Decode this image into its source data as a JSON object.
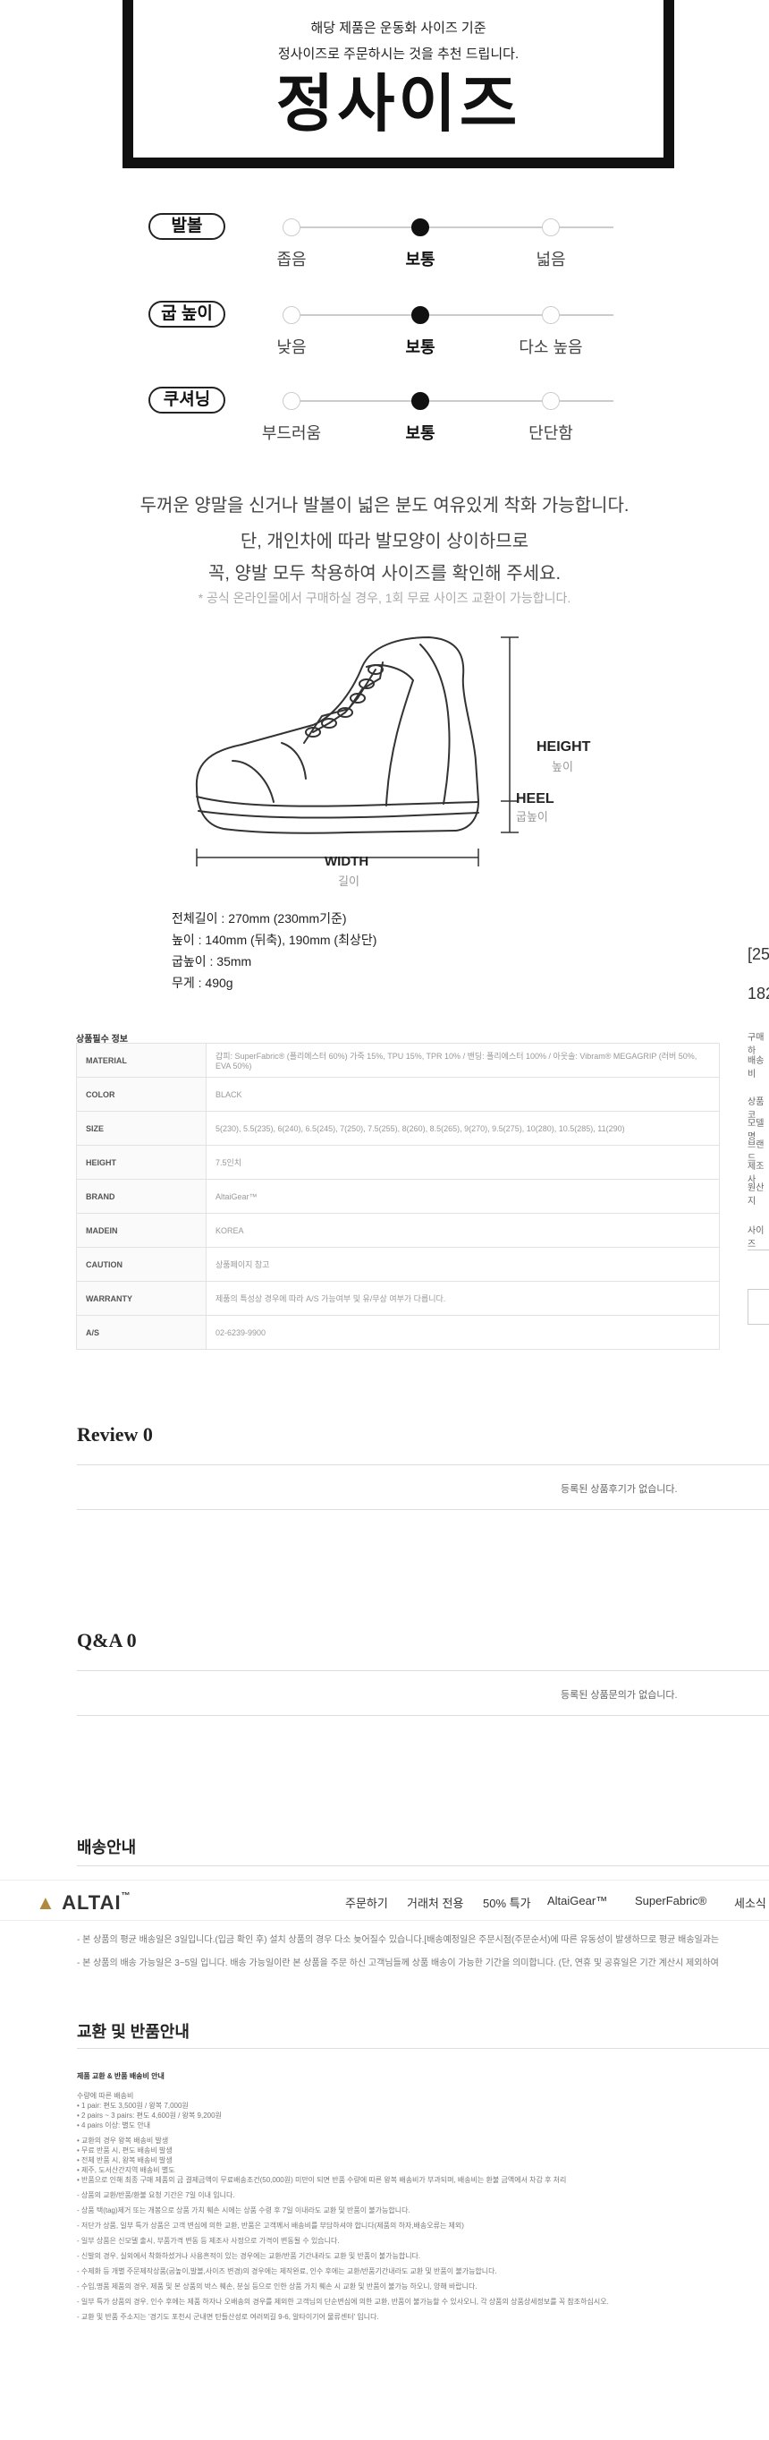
{
  "size_box": {
    "line1": "해당 제품은 운동화 사이즈 기준",
    "line2": "정사이즈로 주문하시는 것을 추천 드립니다.",
    "big": "정사이즈"
  },
  "scales": [
    {
      "tag": "발볼",
      "labels": [
        "좁음",
        "보통",
        "넓음"
      ],
      "selected": 1
    },
    {
      "tag": "굽 높이",
      "labels": [
        "낮음",
        "보통",
        "다소 높음"
      ],
      "selected": 1
    },
    {
      "tag": "쿠셔닝",
      "labels": [
        "부드러움",
        "보통",
        "단단함"
      ],
      "selected": 1
    }
  ],
  "description": {
    "line1": "두꺼운 양말을 신거나 발볼이 넓은 분도 여유있게 착화 가능합니다.",
    "line2": "단, 개인차에 따라 발모양이 상이하므로",
    "line3": "꼭, 양발 모두 착용하여 사이즈를 확인해 주세요.",
    "note": "* 공식 온라인몰에서 구매하실 경우, 1회 무료 사이즈 교환이 가능합니다."
  },
  "diagram": {
    "height_label": "HEIGHT",
    "height_sub": "높이",
    "heel_label": "HEEL",
    "heel_sub": "굽높이",
    "width_label": "WIDTH",
    "width_sub": "길이"
  },
  "specs": [
    "전체길이 : 270mm (230mm기준)",
    "높이 : 140mm (뒤축), 190mm (최상단)",
    "굽높이 : 35mm",
    "무게 : 490g"
  ],
  "product_info": {
    "title": "상품필수 정보",
    "rows": [
      {
        "key": "MATERIAL",
        "value": "갑피: SuperFabric® (폴리에스터 60%) 가죽 15%, TPU 15%, TPR 10% / 밴딩: 폴리에스터 100% / 아웃솔: Vibram® MEGAGRIP (러버 50%, EVA 50%)"
      },
      {
        "key": "COLOR",
        "value": "BLACK"
      },
      {
        "key": "SIZE",
        "value": "5(230), 5.5(235), 6(240), 6.5(245), 7(250), 7.5(255), 8(260), 8.5(265), 9(270), 9.5(275), 10(280), 10.5(285), 11(290)"
      },
      {
        "key": "HEIGHT",
        "value": "7.5인치"
      },
      {
        "key": "BRAND",
        "value": "AltaiGear™"
      },
      {
        "key": "MADEIN",
        "value": "KOREA"
      },
      {
        "key": "CAUTION",
        "value": "상품페이지 참고"
      },
      {
        "key": "WARRANTY",
        "value": "제품의 특성상 경우에 따라 A/S 가능여부 및 유/무상 여부가 다릅니다."
      },
      {
        "key": "A/S",
        "value": "02-6239-9900"
      }
    ]
  },
  "review": {
    "title": "Review 0",
    "empty": "등록된 상품후기가 없습니다."
  },
  "qna": {
    "title": "Q&A 0",
    "empty": "등록된 상품문의가 없습니다."
  },
  "shipping": {
    "title": "배송안내",
    "line1": "- 본 상품의 평균 배송일은 3일입니다.(입금 확인 후) 설치 상품의 경우 다소 늦어질수 있습니다.[배송예정일은 주문시점(주문순서)에 따른 유동성이 발생하므로 평균 배송일과는",
    "line2": "- 본 상품의 배송 가능일은 3~5일 입니다. 배송 가능일이란 본 상품을 주문 하신 고객님들께 상품 배송이 가능한 기간을 의미합니다. (단, 연휴 및 공휴일은 기간 계산시 제외하여"
  },
  "navbar": {
    "logo": "ALTAI",
    "logo_mark": "™",
    "items": [
      "주문하기",
      "거래처 전용",
      "50% 특가",
      "AltaiGear™",
      "SuperFabric®",
      "세소식"
    ]
  },
  "exchange": {
    "title": "교환 및 반품안내",
    "heading": "제품 교환 & 반품 배송비 안내",
    "lines": [
      "수량에 따른 배송비",
      "• 1 pair: 편도 3,500원 / 왕복 7,000원",
      "• 2 pairs ~ 3 pairs: 편도 4,600원 / 왕복 9,200원",
      "• 4 pairs 이상: 별도 안내",
      "",
      "• 교환의 경우 왕복 배송비 발생",
      "• 무료 반품 시, 편도 배송비 발생",
      "• 전체 반품 시, 왕복 배송비 발생",
      "• 제주, 도서산간지역 배송비 별도",
      "• 반품으로 인해 최종 구매 제품의 금 결제금액이 무료배송조건(50,000원) 미만이 되면 반품 수량에 따른 왕복 배송비가 부과되며, 배송비는 환불 금액에서 차감 후 처리",
      "",
      "- 상품의 교환/반품/환불 요청 기간은 7일 이내 입니다.",
      "",
      "- 상품 택(tag)제거 또는 개봉으로 상품 가치 훼손 시에는 상품 수령 후 7일 이내라도 교환 및 반품이 불가능합니다.",
      "",
      "- 저단가 상품, 일부 특가 상품은 고객 변심에 의한 교환, 반품은 고객께서 배송비를 부담하셔야 합니다(제품의 하자,배송오류는 제외)",
      "",
      "- 일부 상품은 신모델 출시, 부품가격 변동 등 제조사 사정으로 가격이 변동될 수 있습니다.",
      "",
      "- 신발의 경우, 실외에서 착화하셨거나 사용흔적이 있는 경우에는 교환/반품 기간내라도 교환 및 반품이 불가능합니다.",
      "",
      "- 수제화 등 개별 주문제작상품(굽높이,발볼,사이즈 변경)의 경우에는 제작완료, 인수 후에는 교환/반품기간내라도 교환 및 반품이 불가능합니다.",
      "",
      "- 수입,명품 제품의 경우, 제품 및 본 상품의 박스 훼손, 분실 등으로 인한 상품 가치 훼손 시 교환 및 반품이 불가능 하오니, 양해 바랍니다.",
      "",
      "- 일부 특가 상품의 경우, 인수 후에는 제품 하자나 오배송의 경우를 제외한 고객님의 단순변심에 의한 교환, 반품이 불가능할 수 있사오니, 각 상품의 상품상세정보를 꼭 참조하십시오.",
      "",
      "- 교환 및 반품 주소지는 '경기도 포천시 군내면 탄들산성로 여러뫼길 9-6, 알타이기어 물류센터' 입니다."
    ]
  },
  "right_side": {
    "r1": "[25",
    "r2": "182",
    "r3": "구매하",
    "r4": "배송비",
    "r5": "상품코",
    "r6": "모델명",
    "r7": "브랜드",
    "r8": "제조사",
    "r9": "원산지",
    "r10": "사이즈"
  },
  "colors": {
    "accent": "#b08a3e",
    "text": "#333333",
    "border": "#111111"
  }
}
